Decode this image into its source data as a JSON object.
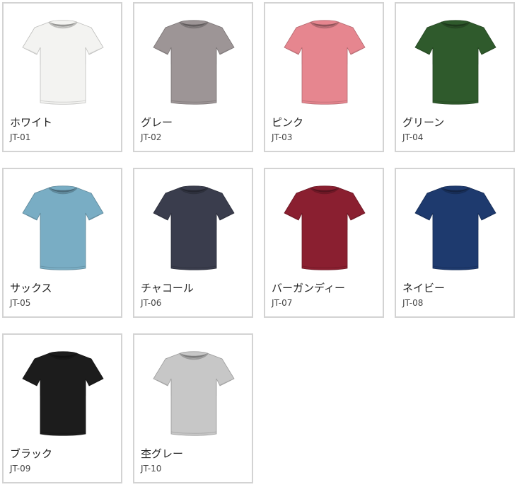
{
  "products": [
    {
      "name": "ホワイト",
      "code": "JT-01",
      "color": "#f3f3f1",
      "icon": "tshirt-icon"
    },
    {
      "name": "グレー",
      "code": "JT-02",
      "color": "#9d9596",
      "icon": "tshirt-icon"
    },
    {
      "name": "ピンク",
      "code": "JT-03",
      "color": "#e6868f",
      "icon": "tshirt-icon"
    },
    {
      "name": "グリーン",
      "code": "JT-04",
      "color": "#2f5a2c",
      "icon": "tshirt-icon"
    },
    {
      "name": "サックス",
      "code": "JT-05",
      "color": "#79adc4",
      "icon": "tshirt-icon"
    },
    {
      "name": "チャコール",
      "code": "JT-06",
      "color": "#3a3d4d",
      "icon": "tshirt-icon"
    },
    {
      "name": "バーガンディー",
      "code": "JT-07",
      "color": "#8a1f30",
      "icon": "tshirt-icon"
    },
    {
      "name": "ネイビー",
      "code": "JT-08",
      "color": "#1e3a6e",
      "icon": "tshirt-icon"
    },
    {
      "name": "ブラック",
      "code": "JT-09",
      "color": "#1c1c1c",
      "icon": "tshirt-icon"
    },
    {
      "name": "杢グレー",
      "code": "JT-10",
      "color": "#c7c7c7",
      "icon": "tshirt-icon"
    }
  ]
}
